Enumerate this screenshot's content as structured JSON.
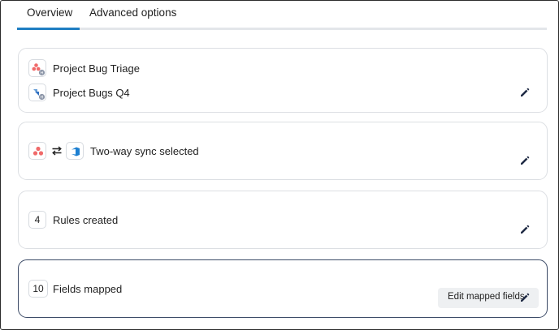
{
  "tabs": [
    {
      "label": "Overview",
      "active": true
    },
    {
      "label": "Advanced options",
      "active": false
    }
  ],
  "projects": {
    "source": {
      "name": "Project Bug Triage",
      "icon": "asana-logo-icon"
    },
    "target": {
      "name": "Project Bugs Q4",
      "icon": "jira-logo-icon"
    }
  },
  "sync": {
    "label": "Two-way sync selected",
    "left_icon": "asana-logo-icon",
    "direction_icon": "two-way-arrows-icon",
    "right_icon": "azure-devops-logo-icon"
  },
  "rules": {
    "count": "4",
    "label": "Rules created"
  },
  "fields": {
    "count": "10",
    "label": "Fields mapped",
    "button_label": "Edit mapped fields"
  },
  "colors": {
    "accent": "#1f7ec2",
    "asana": "#f06a6a",
    "active_border": "#3b4a66",
    "button_bg": "#eef0f2"
  },
  "edit_icon": "pencil-icon"
}
